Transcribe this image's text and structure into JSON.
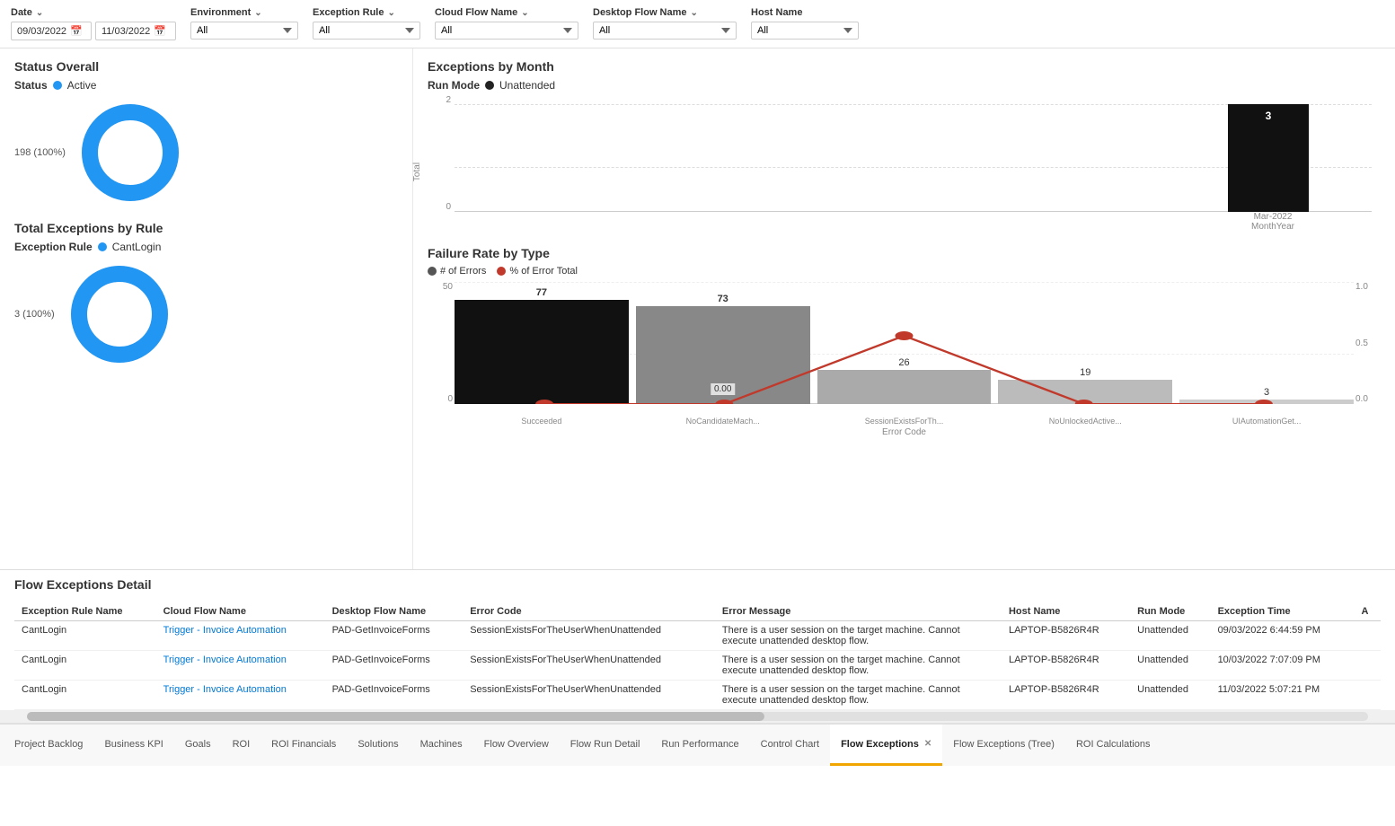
{
  "filters": {
    "date_label": "Date",
    "date_from": "09/03/2022",
    "date_to": "11/03/2022",
    "environment_label": "Environment",
    "environment_value": "All",
    "exception_rule_label": "Exception Rule",
    "exception_rule_value": "All",
    "cloud_flow_name_label": "Cloud Flow Name",
    "cloud_flow_name_value": "All",
    "desktop_flow_name_label": "Desktop Flow Name",
    "desktop_flow_name_value": "All",
    "host_name_label": "Host Name",
    "host_name_value": "All"
  },
  "status_overall": {
    "title": "Status Overall",
    "status_label": "Status",
    "status_value": "Active",
    "donut_label": "198 (100%)",
    "donut_percent": 100
  },
  "exceptions_by_rule": {
    "title": "Total Exceptions by Rule",
    "rule_label": "Exception Rule",
    "rule_value": "CantLogin",
    "donut_label": "3 (100%)",
    "donut_percent": 100
  },
  "exceptions_by_month": {
    "title": "Exceptions by Month",
    "run_mode_label": "Run Mode",
    "run_mode_value": "Unattended",
    "bar_value": "3",
    "month_label": "Mar-2022",
    "x_axis_title": "MonthYear",
    "y_axis_values": [
      "2",
      "0"
    ],
    "y_axis_title": "Total"
  },
  "failure_rate": {
    "title": "Failure Rate by Type",
    "legend": [
      {
        "label": "# of Errors",
        "color": "#555"
      },
      {
        "label": "% of Error Total",
        "color": "#c0392b"
      }
    ],
    "y_axis_label": "# of Errors",
    "x_axis_label": "Error Code",
    "bars": [
      {
        "label": "Succeeded",
        "value": 77,
        "color": "#111"
      },
      {
        "label": "NoCandidateMach...",
        "value": 73,
        "color": "#888"
      },
      {
        "label": "SessionExistsForTh...",
        "value": 26,
        "color": "#aaa"
      },
      {
        "label": "NoUnlockedActive...",
        "value": 19,
        "color": "#bbb"
      },
      {
        "label": "UIAutomationGet...",
        "value": 3,
        "color": "#ccc"
      }
    ],
    "y_ticks": [
      "50",
      "0"
    ],
    "y_ticks_right": [
      "1.0",
      "0.5",
      "0.0"
    ],
    "line_values": [
      {
        "x": 0,
        "y": 0
      },
      {
        "x": 1,
        "y": 0
      },
      {
        "x": 2,
        "y": 0.5
      },
      {
        "x": 3,
        "y": 0
      },
      {
        "x": 4,
        "y": 0
      }
    ]
  },
  "detail_table": {
    "title": "Flow Exceptions Detail",
    "columns": [
      "Exception Rule Name",
      "Cloud Flow Name",
      "Desktop Flow Name",
      "Error Code",
      "Error Message",
      "Host Name",
      "Run Mode",
      "Exception Time",
      "A"
    ],
    "rows": [
      {
        "exception_rule": "CantLogin",
        "cloud_flow_name": "Trigger - Invoice Automation",
        "desktop_flow_name": "PAD-GetInvoiceForms",
        "error_code": "SessionExistsForTheUserWhenUnattended",
        "error_message": "There is a user session on the target machine. Cannot execute unattended desktop flow.",
        "host_name": "LAPTOP-B5826R4R",
        "run_mode": "Unattended",
        "exception_time": "09/03/2022 6:44:59 PM"
      },
      {
        "exception_rule": "CantLogin",
        "cloud_flow_name": "Trigger - Invoice Automation",
        "desktop_flow_name": "PAD-GetInvoiceForms",
        "error_code": "SessionExistsForTheUserWhenUnattended",
        "error_message": "There is a user session on the target machine. Cannot execute unattended desktop flow.",
        "host_name": "LAPTOP-B5826R4R",
        "run_mode": "Unattended",
        "exception_time": "10/03/2022 7:07:09 PM"
      },
      {
        "exception_rule": "CantLogin",
        "cloud_flow_name": "Trigger - Invoice Automation",
        "desktop_flow_name": "PAD-GetInvoiceForms",
        "error_code": "SessionExistsForTheUserWhenUnattended",
        "error_message": "There is a user session on the target machine. Cannot execute unattended desktop flow.",
        "host_name": "LAPTOP-B5826R4R",
        "run_mode": "Unattended",
        "exception_time": "11/03/2022 5:07:21 PM"
      }
    ]
  },
  "tabs": [
    {
      "label": "Project Backlog",
      "active": false,
      "closeable": false
    },
    {
      "label": "Business KPI",
      "active": false,
      "closeable": false
    },
    {
      "label": "Goals",
      "active": false,
      "closeable": false
    },
    {
      "label": "ROI",
      "active": false,
      "closeable": false
    },
    {
      "label": "ROI Financials",
      "active": false,
      "closeable": false
    },
    {
      "label": "Solutions",
      "active": false,
      "closeable": false
    },
    {
      "label": "Machines",
      "active": false,
      "closeable": false
    },
    {
      "label": "Flow Overview",
      "active": false,
      "closeable": false
    },
    {
      "label": "Flow Run Detail",
      "active": false,
      "closeable": false
    },
    {
      "label": "Run Performance",
      "active": false,
      "closeable": false
    },
    {
      "label": "Control Chart",
      "active": false,
      "closeable": false
    },
    {
      "label": "Flow Exceptions",
      "active": true,
      "closeable": true
    },
    {
      "label": "Flow Exceptions (Tree)",
      "active": false,
      "closeable": false
    },
    {
      "label": "ROI Calculations",
      "active": false,
      "closeable": false
    }
  ]
}
